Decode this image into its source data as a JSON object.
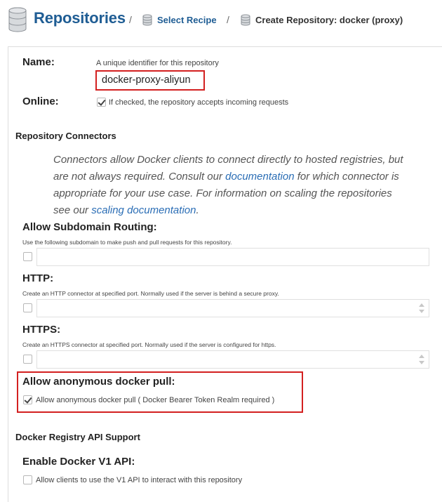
{
  "header": {
    "title": "Repositories",
    "sep": "/",
    "crumb1": "Select Recipe",
    "crumb2": "Create Repository: docker (proxy)"
  },
  "name": {
    "label": "Name:",
    "help": "A unique identifier for this repository",
    "value": "docker-proxy-aliyun"
  },
  "online": {
    "label": "Online:",
    "checkbox_label": "If checked, the repository accepts incoming requests",
    "checked": true
  },
  "connectors": {
    "title": "Repository Connectors",
    "desc_1": "Connectors allow Docker clients to connect directly to hosted registries, but are not always required. Consult our ",
    "link_1": "documentation",
    "desc_2": " for which connector is appropriate for your use case. For information on scaling the repositories see our ",
    "link_2": "scaling documentation",
    "desc_3": "."
  },
  "subdomain": {
    "label": "Allow Subdomain Routing:",
    "help": "Use the following subdomain to make push and pull requests for this repository.",
    "value": ""
  },
  "http": {
    "label": "HTTP:",
    "help": "Create an HTTP connector at specified port. Normally used if the server is behind a secure proxy.",
    "value": ""
  },
  "https": {
    "label": "HTTPS:",
    "help": "Create an HTTPS connector at specified port. Normally used if the server is configured for https.",
    "value": ""
  },
  "anonymous": {
    "label": "Allow anonymous docker pull:",
    "checkbox_label": "Allow anonymous docker pull ( Docker Bearer Token Realm required )",
    "checked": true
  },
  "api_support": {
    "title": "Docker Registry API Support"
  },
  "v1": {
    "label": "Enable Docker V1 API:",
    "checkbox_label": "Allow clients to use the V1 API to interact with this repository",
    "checked": false
  },
  "colors": {
    "brand": "#1f5d94",
    "link": "#2a6db5",
    "highlight": "#d32020"
  }
}
